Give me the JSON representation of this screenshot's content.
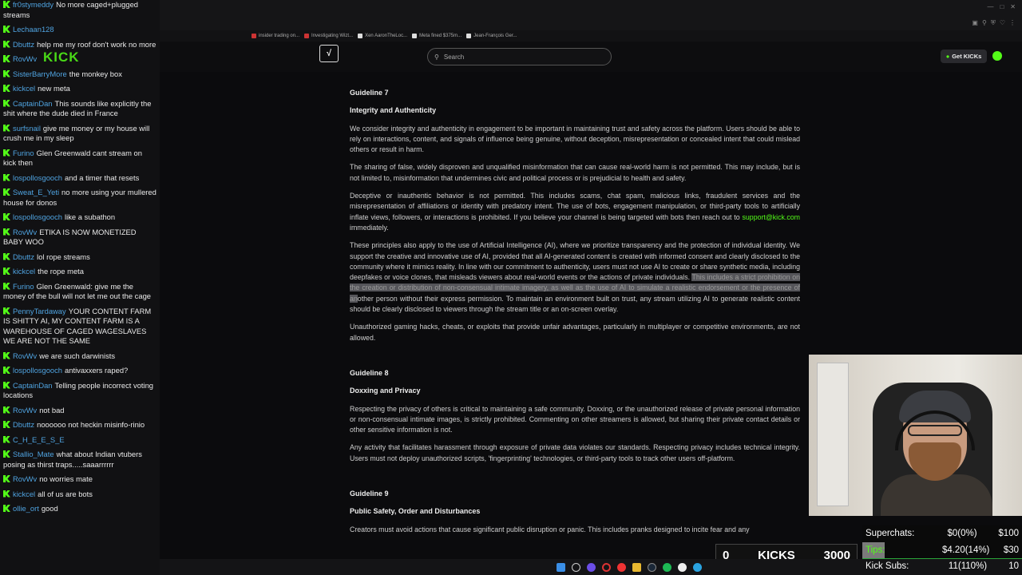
{
  "bookmarks": [
    {
      "label": "insider trading on..."
    },
    {
      "label": "Investigating Wizt..."
    },
    {
      "label": "Xen AaronTheLoc..."
    },
    {
      "label": "Meta fined $375m..."
    },
    {
      "label": "Jean-François Ger..."
    }
  ],
  "header": {
    "search_placeholder": "Search",
    "get_kicks": "Get KICKs"
  },
  "guidelines": {
    "g7": {
      "heading": "Guideline 7",
      "title": "Integrity and Authenticity",
      "p1": "We consider integrity and authenticity in engagement to be important in maintaining trust and safety across the platform. Users should be able to rely on interactions, content, and signals of influence being genuine, without deception, misrepresentation or concealed intent that could mislead others or result in harm.",
      "p2": "The sharing of false, widely disproven and unqualified misinformation that can cause real-world harm is not permitted. This may include, but is not limited to, misinformation that undermines civic and political process or is prejudicial to health and safety.",
      "p3": "Deceptive or inauthentic behavior is not permitted. This includes scams, chat spam, malicious links, fraudulent services and the misrepresentation of affiliations or identity with predatory intent. The use of bots, engagement manipulation, or third-party tools to artificially inflate views, followers, or interactions is prohibited. If you believe your channel is being targeted with bots then reach out to",
      "p3_link": "support@kick.com",
      "p3_end": " immediately.",
      "p4a": "These principles also apply to the use of Artificial Intelligence (AI), where we prioritize transparency and the protection of individual identity. We support the creative and innovative use of AI, provided that all AI-generated content is created with informed consent and clearly disclosed to the community where it mimics reality. In line with our commitment to authenticity, users must not use AI to create or share synthetic media, including deepfakes or voice clones, that misleads viewers about real-world events or the actions of private individuals. ",
      "p4_highlight": "This includes a strict prohibition on the creation or distribution of non-consensual intimate imagery, as well as the use of AI to simulate a realistic endorsement or the presence of an",
      "p4b": "other person without their express permission. To maintain an environment built on trust, any stream utilizing AI to generate realistic content should be clearly disclosed to viewers through the stream title or an on-screen overlay.",
      "p5": "Unauthorized gaming hacks, cheats, or exploits that provide unfair advantages, particularly in multiplayer or competitive environments, are not allowed."
    },
    "g8": {
      "heading": "Guideline 8",
      "title": "Doxxing and Privacy",
      "p1": "Respecting the privacy of others is critical to maintaining a safe community. Doxxing, or the unauthorized release of private personal information or non-consensual intimate images, is strictly prohibited. Commenting on other streamers is allowed, but sharing their private contact details or other sensitive information is not.",
      "p2": "Any activity that facilitates harassment through exposure of private data violates our standards. Respecting privacy includes technical integrity. Users must not deploy unauthorized scripts, 'fingerprinting' technologies, or third-party tools to track other users off-platform."
    },
    "g9": {
      "heading": "Guideline 9",
      "title": "Public Safety, Order and Disturbances",
      "p1": "Creators must avoid actions that cause significant public disruption or panic. This includes pranks designed to incite fear and any"
    }
  },
  "chat": [
    {
      "user": "fr0stymeddy",
      "text": "No more caged+plugged streams"
    },
    {
      "user": "Lechaan128",
      "text": ""
    },
    {
      "user": "Dbuttz",
      "text": "help me my roof don't work no more"
    },
    {
      "user": "RovWv",
      "text": ""
    },
    {
      "user": "SisterBarryMore",
      "text": "the monkey box"
    },
    {
      "user": "kickcel",
      "text": "new meta"
    },
    {
      "user": "CaptainDan",
      "text": "This sounds like explicitly the shit where the dude died in France"
    },
    {
      "user": "surfsnail",
      "text": "give me money or my house will crush me in my sleep"
    },
    {
      "user": "Furino",
      "text": "Glen Greenwald cant stream on kick then"
    },
    {
      "user": "lospollosgooch",
      "text": "and a timer that resets"
    },
    {
      "user": "Sweat_E_Yeti",
      "text": "no more using your mullered house for donos"
    },
    {
      "user": "lospollosgooch",
      "text": "like a subathon"
    },
    {
      "user": "RovWv",
      "text": "ETIKA IS NOW MONETIZED BABY WOO"
    },
    {
      "user": "Dbuttz",
      "text": "lol rope streams"
    },
    {
      "user": "kickcel",
      "text": "the rope meta"
    },
    {
      "user": "Furino",
      "text": "Glen Greenwald: give me the money of the bull will not let me out the cage"
    },
    {
      "user": "PennyTardaway",
      "text": "YOUR CONTENT FARM IS SHITTY AI, MY CONTENT FARM IS A WAREHOUSE OF CAGED WAGESLAVES WE ARE NOT THE SAME"
    },
    {
      "user": "RovWv",
      "text": "we are such darwinists"
    },
    {
      "user": "lospollosgooch",
      "text": "antivaxxers raped?"
    },
    {
      "user": "CaptainDan",
      "text": "Telling people incorrect voting locations"
    },
    {
      "user": "RovWv",
      "text": "not bad"
    },
    {
      "user": "Dbuttz",
      "text": "noooooo not heckin misinfo-rinio"
    },
    {
      "user": "C_H_E_E_S_E",
      "text": ""
    },
    {
      "user": "Stallio_Mate",
      "text": "what about Indian vtubers posing as thirst traps.....saaarrrrrr"
    },
    {
      "user": "RovWv",
      "text": "no worries mate"
    },
    {
      "user": "kickcel",
      "text": "all of us are bots"
    },
    {
      "user": "ollie_ort",
      "text": "good"
    }
  ],
  "stats": {
    "superchats": {
      "label": "Superchats:",
      "value": "$0(0%)",
      "goal": "$100",
      "fraction": 0
    },
    "tips": {
      "label": "Tips:",
      "value": "$4.20(14%)",
      "goal": "$30",
      "fraction": 0.14
    },
    "kick_subs": {
      "label": "Kick Subs:",
      "value": "11(110%)",
      "goal": "10",
      "fraction": 1.0
    }
  },
  "kicks": {
    "left": "0",
    "label": "KICKS",
    "value": "3000"
  },
  "colors": {
    "accent": "#53fc18",
    "username": "#4fa3e0",
    "kick_subs_fill": "#2aa63a",
    "tips_fill": "#7a7a7a"
  }
}
